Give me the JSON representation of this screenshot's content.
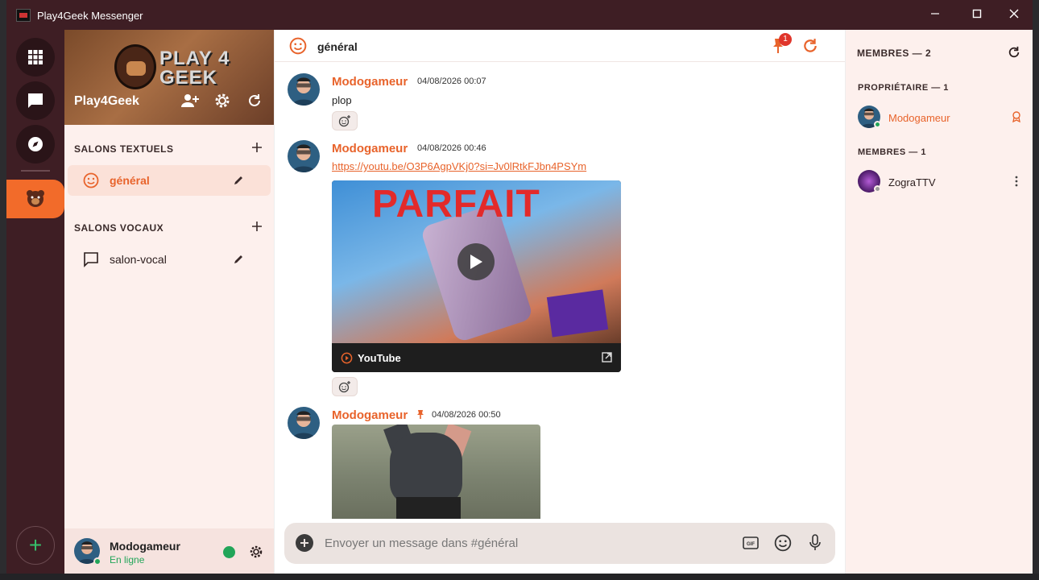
{
  "window": {
    "title": "Play4Geek Messenger",
    "minimize": "—",
    "maximize": "☐",
    "close": "✕"
  },
  "colors": {
    "accent": "#e8632b",
    "titlebar": "#3e1e24",
    "online": "#22a559",
    "badge": "#e0352b"
  },
  "rail": {
    "items": [
      {
        "icon": "grid-icon"
      },
      {
        "icon": "chat-bubble-icon"
      },
      {
        "icon": "compass-icon"
      }
    ],
    "server_icon": "bear-mascot-icon",
    "add_label": "+"
  },
  "server": {
    "name": "Play4Geek",
    "banner_wordmark_line1": "PLAY 4",
    "banner_wordmark_line2": "GEEK"
  },
  "channels": {
    "text_section": "SALONS TEXTUELS",
    "voice_section": "SALONS VOCAUX",
    "text_items": [
      {
        "label": "général",
        "active": true
      }
    ],
    "voice_items": [
      {
        "label": "salon-vocal"
      }
    ]
  },
  "user": {
    "name": "Modogameur",
    "status": "En ligne"
  },
  "chat": {
    "channel_title": "général",
    "pin_count": "1",
    "messages": [
      {
        "author": "Modogameur",
        "time": "04/08/2026 00:07",
        "text": "plop"
      },
      {
        "author": "Modogameur",
        "time": "04/08/2026 00:46",
        "link": "https://youtu.be/O3P6AgpVKj0?si=Jv0lRtkFJbn4PSYm",
        "embed": {
          "provider": "YouTube",
          "thumb_title": "PARFAIT"
        }
      },
      {
        "author": "Modogameur",
        "time": "04/08/2026 00:50",
        "pinned": true
      }
    ],
    "composer_placeholder": "Envoyer un message dans #général"
  },
  "members": {
    "title": "MEMBRES — 2",
    "owner_section": "PROPRIÉTAIRE — 1",
    "member_section": "MEMBRES — 1",
    "owner": {
      "name": "Modogameur"
    },
    "member": {
      "name": "ZograTTV"
    }
  }
}
